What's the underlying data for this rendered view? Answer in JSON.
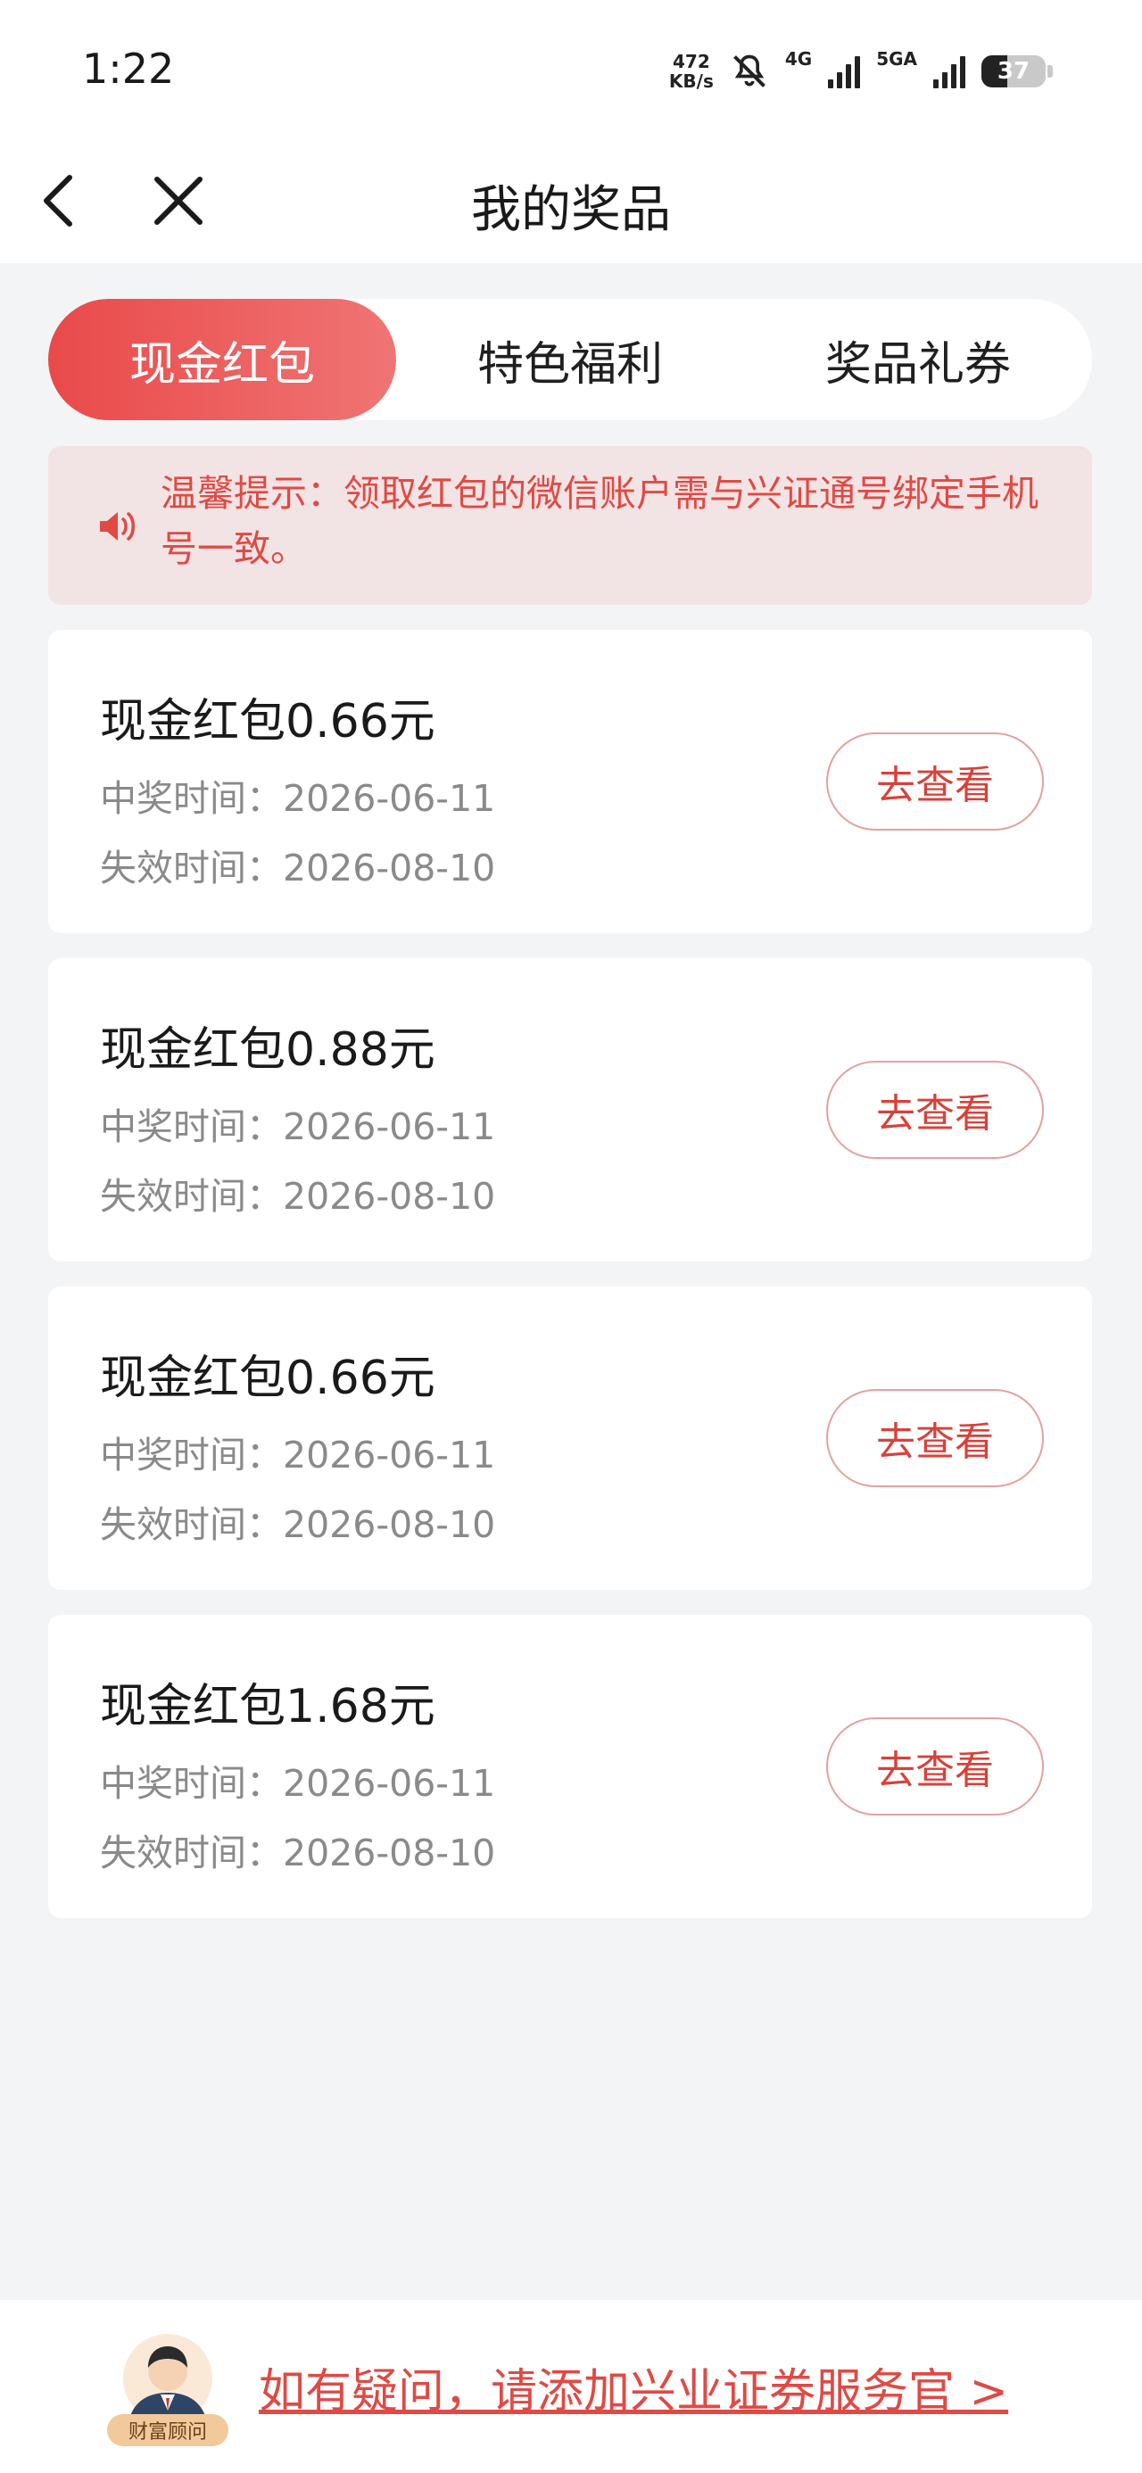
{
  "status_bar": {
    "time": "1:22",
    "net_speed_value": "472",
    "net_speed_unit": "KB/s",
    "sim1_label": "4G",
    "sim2_label": "5GA",
    "battery": "37",
    "icons": [
      "bell-muted-icon",
      "signal-icon",
      "battery-icon"
    ]
  },
  "nav": {
    "title": "我的奖品",
    "back_icon": "chevron-left-icon",
    "close_icon": "close-icon"
  },
  "tabs": [
    {
      "label": "现金红包",
      "active": true
    },
    {
      "label": "特色福利",
      "active": false
    },
    {
      "label": "奖品礼券",
      "active": false
    }
  ],
  "tip": {
    "icon": "speaker-icon",
    "text": "温馨提示：领取红包的微信账户需与兴证通号绑定手机号一致。"
  },
  "prizes": [
    {
      "title": "现金红包0.66元",
      "win_label": "中奖时间：",
      "win_date": "2026-06-11",
      "exp_label": "失效时间：",
      "exp_date": "2026-08-10",
      "button": "去查看"
    },
    {
      "title": "现金红包0.88元",
      "win_label": "中奖时间：",
      "win_date": "2026-06-11",
      "exp_label": "失效时间：",
      "exp_date": "2026-08-10",
      "button": "去查看"
    },
    {
      "title": "现金红包0.66元",
      "win_label": "中奖时间：",
      "win_date": "2026-06-11",
      "exp_label": "失效时间：",
      "exp_date": "2026-08-10",
      "button": "去查看"
    },
    {
      "title": "现金红包1.68元",
      "win_label": "中奖时间：",
      "win_date": "2026-06-11",
      "exp_label": "失效时间：",
      "exp_date": "2026-08-10",
      "button": "去查看"
    }
  ],
  "footer": {
    "advisor_badge": "财富顾问",
    "link_text": "如有疑问，请添加兴业证券服务官 >"
  },
  "colors": {
    "accent": "#e94a4a",
    "tip_bg": "#f2e3e4",
    "page_bg": "#f3f4f6"
  }
}
